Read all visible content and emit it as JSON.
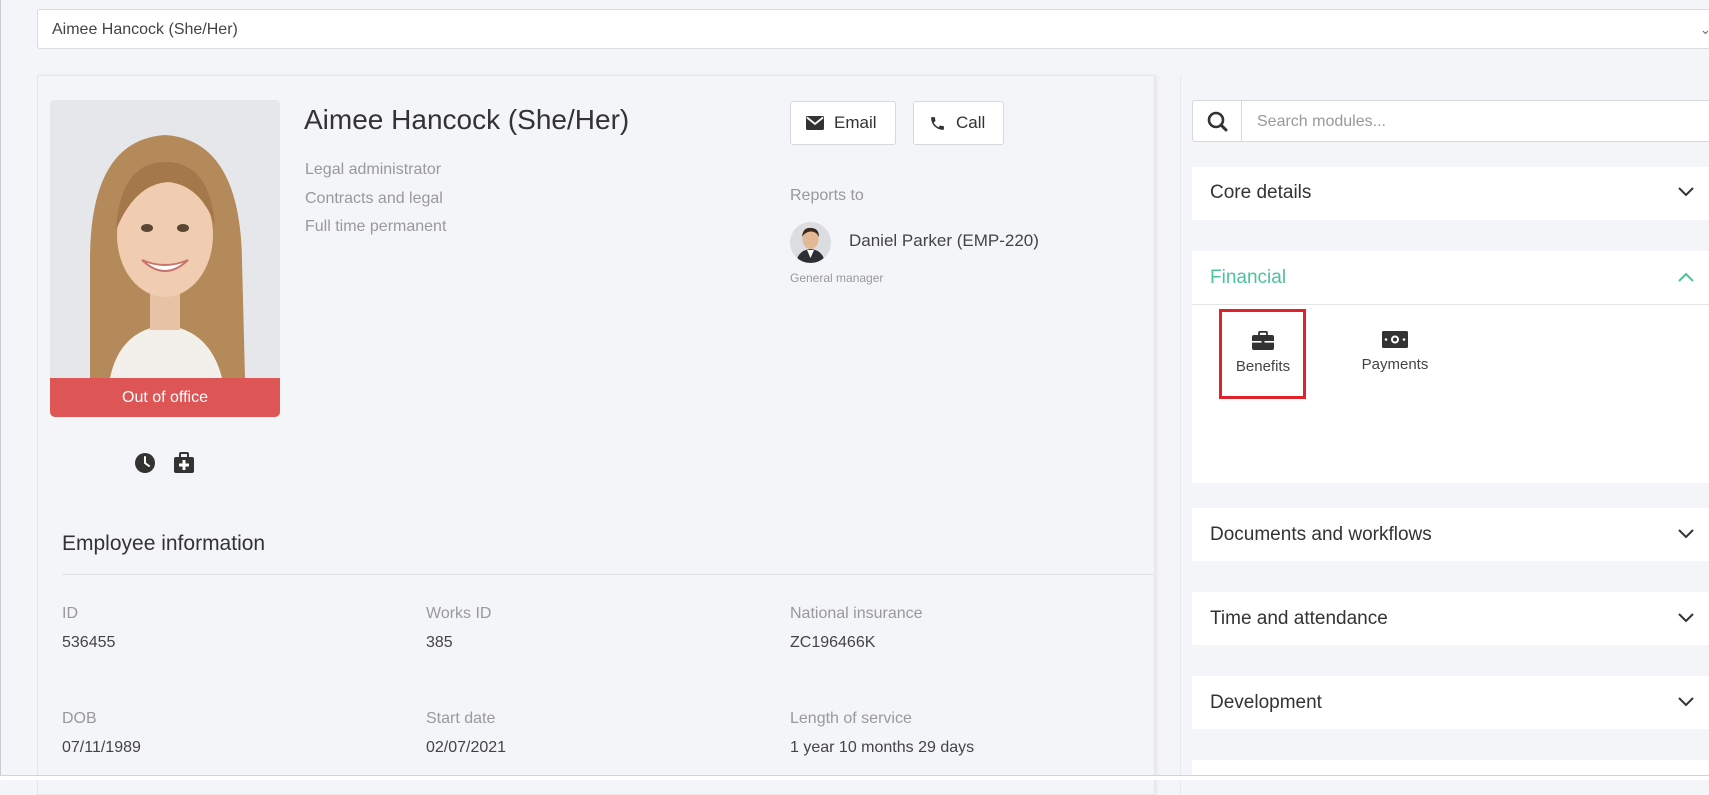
{
  "selector": {
    "value": "Aimee Hancock (She/Her)"
  },
  "profile": {
    "name": "Aimee Hancock (She/Her)",
    "job_title": "Legal administrator",
    "department": "Contracts and legal",
    "contract": "Full time permanent",
    "status": "Out of office",
    "status_color": "#dd5555"
  },
  "actions": {
    "email": "Email",
    "call": "Call"
  },
  "reports": {
    "label": "Reports to",
    "manager_name": "Daniel Parker (EMP-220)",
    "manager_title": "General manager"
  },
  "employee_info": {
    "title": "Employee information",
    "fields": [
      {
        "label": "ID",
        "value": "536455"
      },
      {
        "label": "Works ID",
        "value": "385"
      },
      {
        "label": "National insurance",
        "value": "ZC196466K"
      },
      {
        "label": "DOB",
        "value": "07/11/1989"
      },
      {
        "label": "Start date",
        "value": "02/07/2021"
      },
      {
        "label": "Length of service",
        "value": "1 year 10 months 29 days"
      }
    ]
  },
  "modules": {
    "search_placeholder": "Search modules...",
    "sections": [
      {
        "label": "Core details",
        "expanded": false
      },
      {
        "label": "Financial",
        "expanded": true,
        "items": [
          {
            "label": "Benefits",
            "icon": "briefcase-icon",
            "highlighted": true
          },
          {
            "label": "Payments",
            "icon": "money-icon"
          }
        ]
      },
      {
        "label": "Documents and workflows",
        "expanded": false
      },
      {
        "label": "Time and attendance",
        "expanded": false
      },
      {
        "label": "Development",
        "expanded": false
      }
    ]
  },
  "colors": {
    "accent": "#4cc39a",
    "highlight": "#e0232a",
    "status": "#dd5555"
  }
}
